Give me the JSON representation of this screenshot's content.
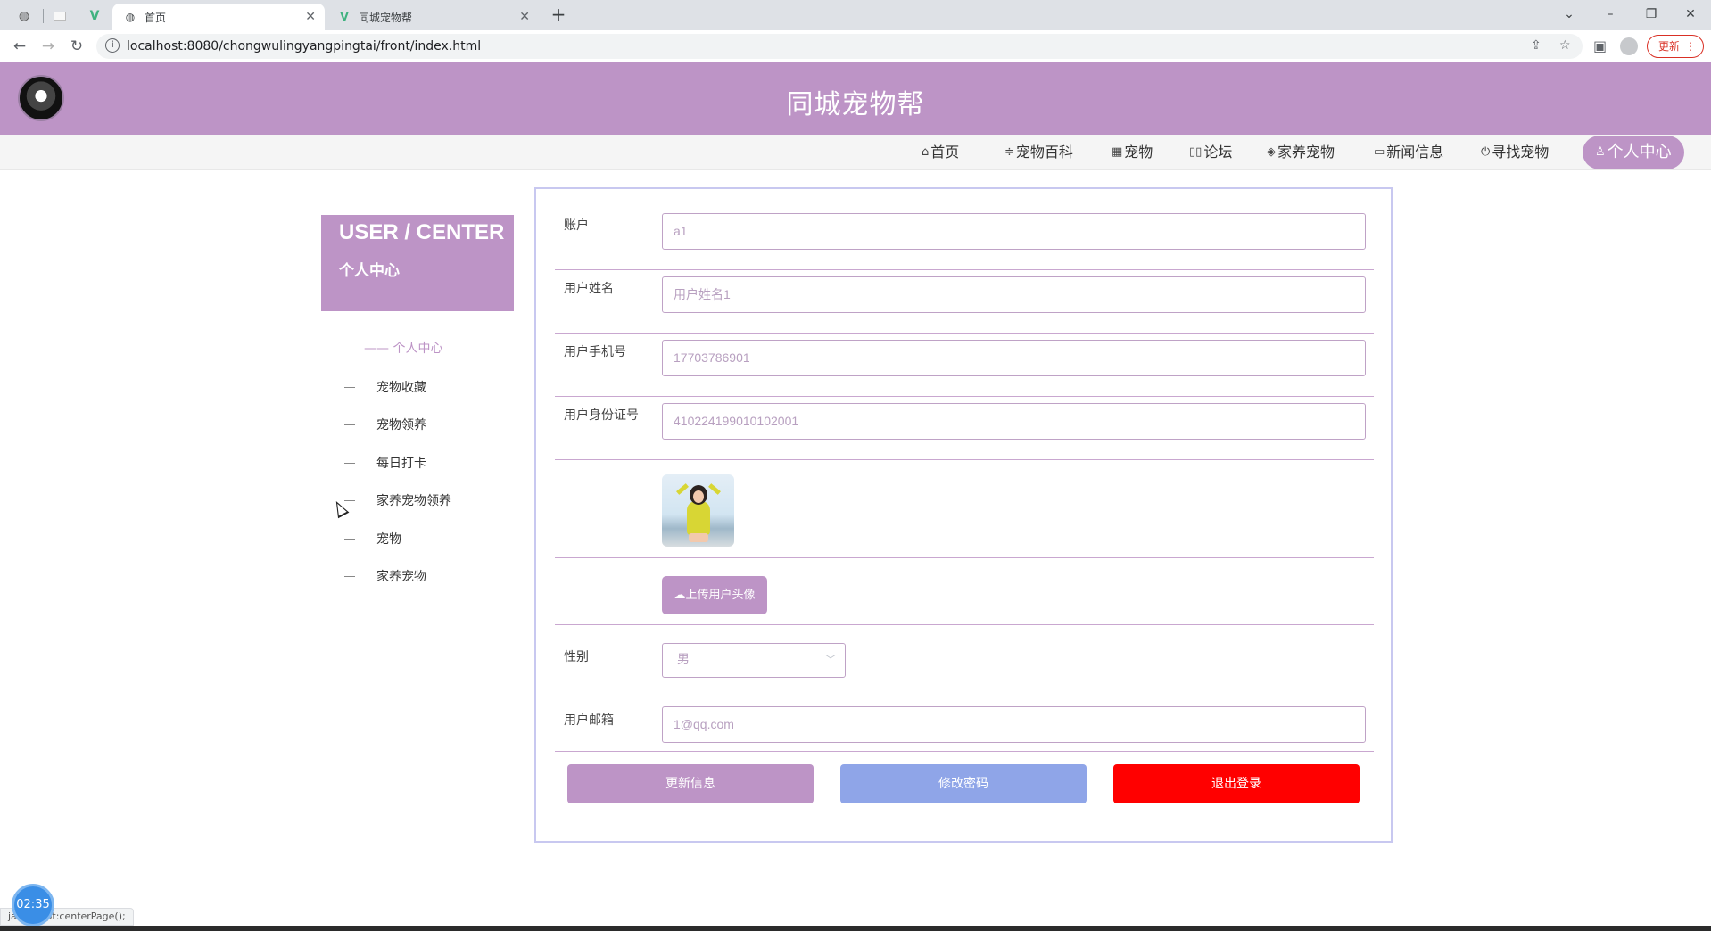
{
  "browser": {
    "tabs": [
      {
        "title": "首页",
        "active": true
      },
      {
        "title": "同城宠物帮",
        "active": false
      }
    ],
    "url": "localhost:8080/chongwulingyangpingtai/front/index.html",
    "update_label": "更新",
    "status_text": "javascript:centerPage();"
  },
  "header": {
    "title": "同城宠物帮"
  },
  "nav": {
    "items": [
      {
        "icon": "home-icon",
        "label": "首页"
      },
      {
        "icon": "sliders-icon",
        "label": "宠物百科"
      },
      {
        "icon": "grid-icon",
        "label": "宠物"
      },
      {
        "icon": "chat-icon",
        "label": "论坛"
      },
      {
        "icon": "stack-icon",
        "label": "家养宠物"
      },
      {
        "icon": "book-icon",
        "label": "新闻信息"
      },
      {
        "icon": "power-icon",
        "label": "寻找宠物"
      },
      {
        "icon": "user-icon",
        "label": "个人中心"
      }
    ],
    "active": "个人中心"
  },
  "sidebar": {
    "title_en": "USER / CENTER",
    "title_cn": "个人中心",
    "active_item": "—— 个人中心",
    "items": [
      "宠物收藏",
      "宠物领养",
      "每日打卡",
      "家养宠物领养",
      "宠物",
      "家养宠物"
    ]
  },
  "form": {
    "account": {
      "label": "账户",
      "value": "a1"
    },
    "name": {
      "label": "用户姓名",
      "value": "用户姓名1"
    },
    "phone": {
      "label": "用户手机号",
      "value": "17703786901"
    },
    "idcard": {
      "label": "用户身份证号",
      "value": "410224199010102001"
    },
    "upload_label": "上传用户头像",
    "gender": {
      "label": "性别",
      "value": "男"
    },
    "email": {
      "label": "用户邮箱",
      "value": "1@qq.com"
    }
  },
  "buttons": {
    "update": "更新信息",
    "password": "修改密码",
    "logout": "退出登录"
  },
  "overlay": {
    "timer": "02:35"
  },
  "colors": {
    "accent": "#bd94c6",
    "password_button": "#8fa5e8",
    "logout_button": "#ff0000"
  }
}
